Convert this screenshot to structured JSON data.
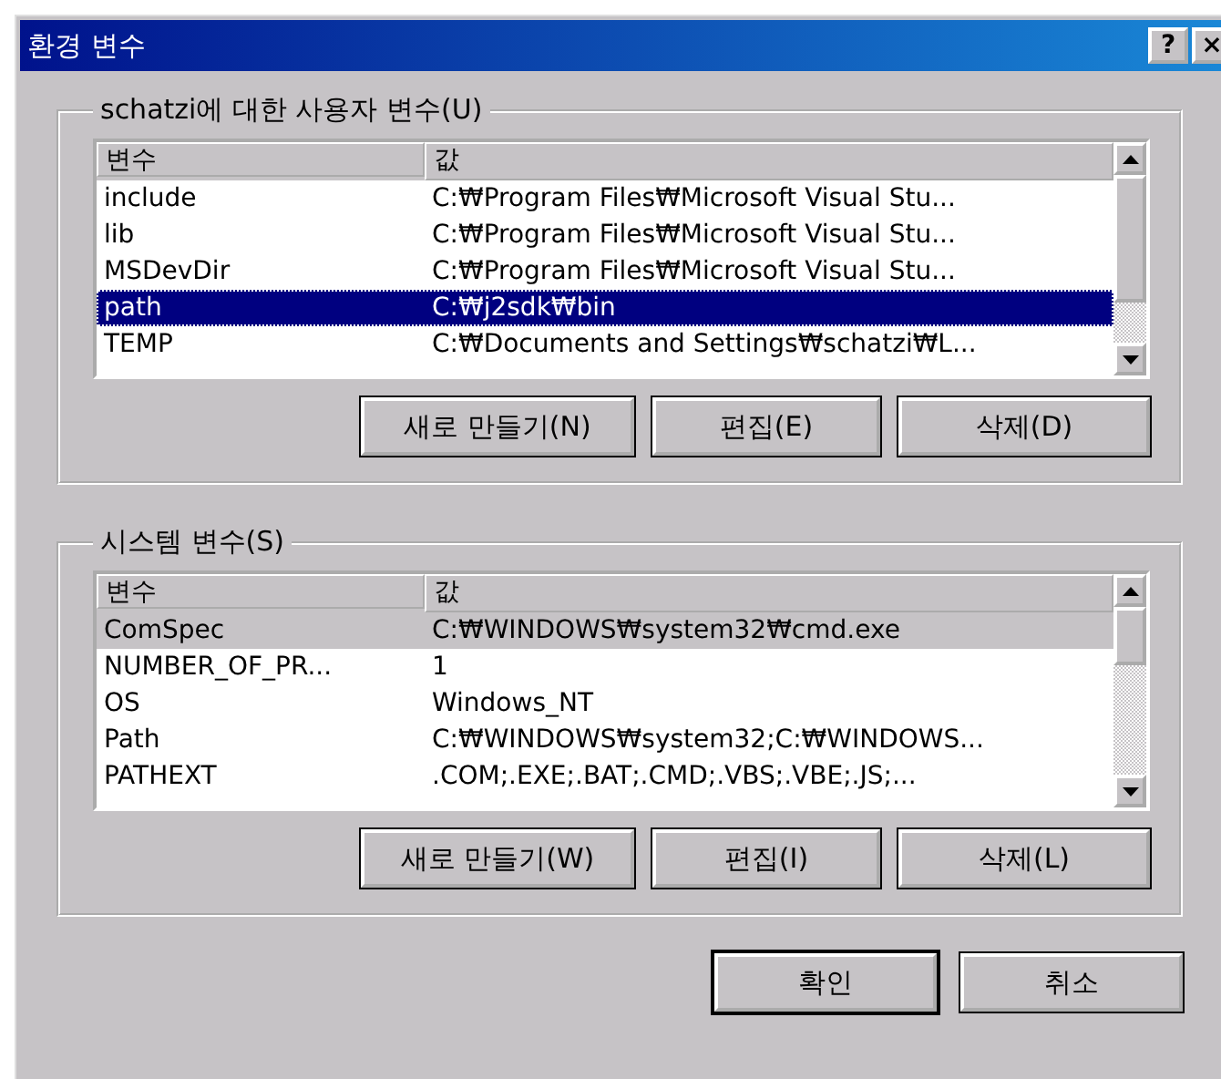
{
  "window": {
    "title": "환경 변수",
    "help_button": "?",
    "close_button": "×"
  },
  "groups": [
    {
      "legend": "schatzi에 대한 사용자 변수(U)",
      "focused": true,
      "columns": [
        "변수",
        "값"
      ],
      "rows": [
        {
          "name": "include",
          "value": "C:₩Program Files₩Microsoft Visual Stu...",
          "selected": false
        },
        {
          "name": "lib",
          "value": "C:₩Program Files₩Microsoft Visual Stu...",
          "selected": false
        },
        {
          "name": "MSDevDir",
          "value": "C:₩Program Files₩Microsoft Visual Stu...",
          "selected": false
        },
        {
          "name": "path",
          "value": "C:₩j2sdk₩bin",
          "selected": true
        },
        {
          "name": "TEMP",
          "value": "C:₩Documents and Settings₩schatzi₩L...",
          "selected": false
        }
      ],
      "buttons": [
        "새로 만들기(N)",
        "편집(E)",
        "삭제(D)"
      ]
    },
    {
      "legend": "시스템 변수(S)",
      "focused": false,
      "columns": [
        "변수",
        "값"
      ],
      "rows": [
        {
          "name": "ComSpec",
          "value": "C:₩WINDOWS₩system32₩cmd.exe",
          "selected": true
        },
        {
          "name": "NUMBER_OF_PR...",
          "value": "1",
          "selected": false
        },
        {
          "name": "OS",
          "value": "Windows_NT",
          "selected": false
        },
        {
          "name": "Path",
          "value": "C:₩WINDOWS₩system32;C:₩WINDOWS...",
          "selected": false
        },
        {
          "name": "PATHEXT",
          "value": ".COM;.EXE;.BAT;.CMD;.VBS;.VBE;.JS;...",
          "selected": false
        }
      ],
      "buttons": [
        "새로 만들기(W)",
        "편집(I)",
        "삭제(L)"
      ]
    }
  ],
  "buttons": [
    "확인",
    "취소"
  ]
}
